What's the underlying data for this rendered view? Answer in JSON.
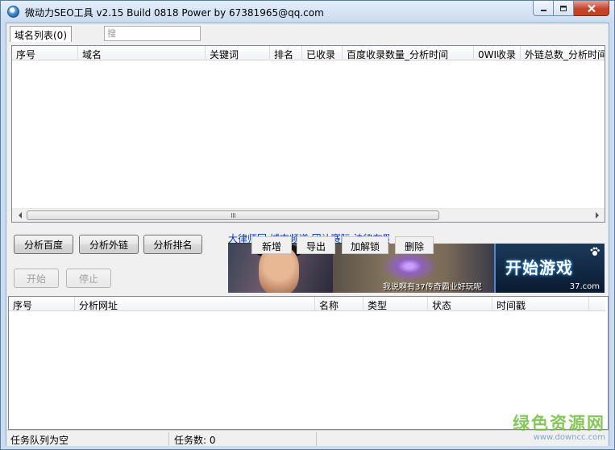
{
  "window": {
    "title": "微动力SEO工具 v2.15 Build 0818 Power by 67381965@qq.com"
  },
  "tabs": {
    "domain_list_label": "域名列表(0)",
    "search_placeholder": "搜"
  },
  "domain_table": {
    "columns": [
      "序号",
      "域名",
      "关键词",
      "排名",
      "已收录",
      "百度收录数量_分析时间",
      "0WI收录",
      "外链总数_分析时间"
    ],
    "rows": []
  },
  "buttons": {
    "analyze_baidu": "分析百度",
    "analyze_links": "分析外链",
    "analyze_rank": "分析排名",
    "start": "开始",
    "stop": "停止"
  },
  "context_menu": {
    "items": [
      "新增",
      "导出",
      "加解锁",
      "删除"
    ]
  },
  "ad": {
    "link_text": "大律师回 域市频道 团让赛际 法律在题 法律咨询",
    "caption": "我说啊有37传奇霸业好玩呢",
    "start_game": "开始游戏",
    "brand": "37.com"
  },
  "task_table": {
    "columns": [
      "序号",
      "分析网址",
      "名称",
      "类型",
      "状态",
      "时间戳"
    ],
    "rows": []
  },
  "statusbar": {
    "queue_status": "任务队列为空",
    "task_count": "任务数: 0"
  },
  "watermark": {
    "main": "绿色资源网",
    "url": "www.downcc.com"
  },
  "colors": {
    "link": "#0033cc",
    "watermark_green": "#6fbf3a",
    "close_red": "#c93d22"
  }
}
